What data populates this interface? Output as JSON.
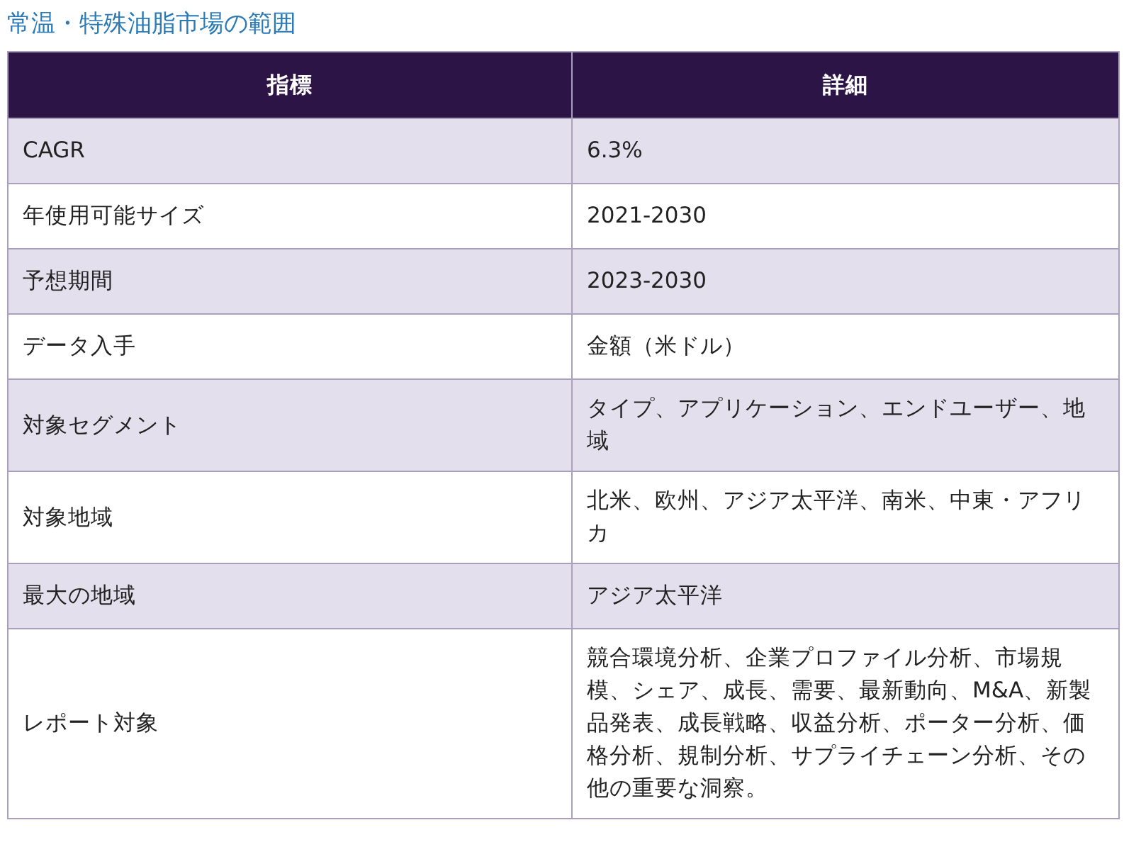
{
  "title": "常温・特殊油脂市場の範囲",
  "table": {
    "columns": [
      "指標",
      "詳細"
    ],
    "rows": [
      [
        "CAGR",
        "6.3%"
      ],
      [
        "年使用可能サイズ",
        "2021-2030"
      ],
      [
        "予想期間",
        "2023-2030"
      ],
      [
        "データ入手",
        "金額（米ドル）"
      ],
      [
        "対象セグメント",
        "タイプ、アプリケーション、エンドユーザー、地域"
      ],
      [
        "対象地域",
        "北米、欧州、アジア太平洋、南米、中東・アフリカ"
      ],
      [
        "最大の地域",
        "アジア太平洋"
      ],
      [
        "レポート対象",
        "競合環境分析、企業プロファイル分析、市場規模、シェア、成長、需要、最新動向、M&A、新製品発表、成長戦略、収益分析、ポーター分析、価格分析、規制分析、サプライチェーン分析、その他の重要な洞察。"
      ]
    ]
  }
}
